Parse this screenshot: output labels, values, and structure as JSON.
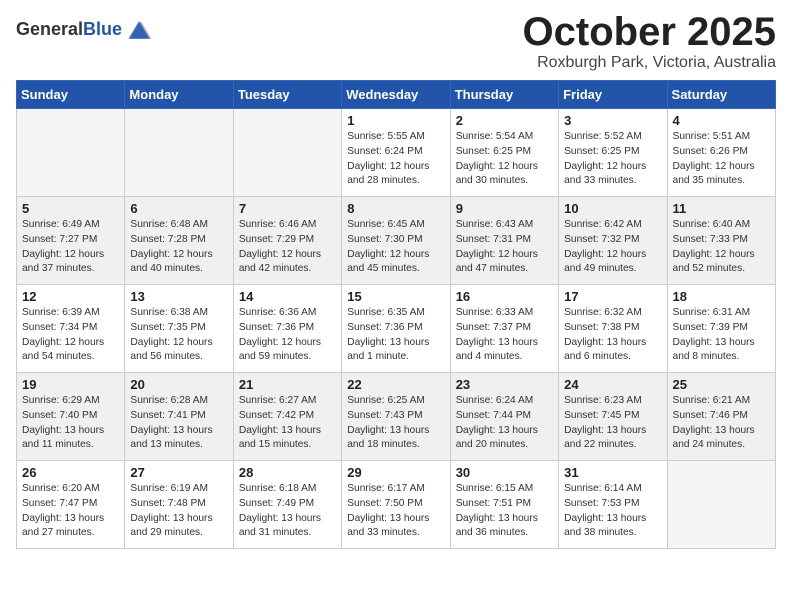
{
  "header": {
    "logo_line1": "General",
    "logo_line2": "Blue",
    "month": "October 2025",
    "location": "Roxburgh Park, Victoria, Australia"
  },
  "weekdays": [
    "Sunday",
    "Monday",
    "Tuesday",
    "Wednesday",
    "Thursday",
    "Friday",
    "Saturday"
  ],
  "weeks": [
    [
      {
        "day": "",
        "info": ""
      },
      {
        "day": "",
        "info": ""
      },
      {
        "day": "",
        "info": ""
      },
      {
        "day": "1",
        "info": "Sunrise: 5:55 AM\nSunset: 6:24 PM\nDaylight: 12 hours\nand 28 minutes."
      },
      {
        "day": "2",
        "info": "Sunrise: 5:54 AM\nSunset: 6:25 PM\nDaylight: 12 hours\nand 30 minutes."
      },
      {
        "day": "3",
        "info": "Sunrise: 5:52 AM\nSunset: 6:25 PM\nDaylight: 12 hours\nand 33 minutes."
      },
      {
        "day": "4",
        "info": "Sunrise: 5:51 AM\nSunset: 6:26 PM\nDaylight: 12 hours\nand 35 minutes."
      }
    ],
    [
      {
        "day": "5",
        "info": "Sunrise: 6:49 AM\nSunset: 7:27 PM\nDaylight: 12 hours\nand 37 minutes."
      },
      {
        "day": "6",
        "info": "Sunrise: 6:48 AM\nSunset: 7:28 PM\nDaylight: 12 hours\nand 40 minutes."
      },
      {
        "day": "7",
        "info": "Sunrise: 6:46 AM\nSunset: 7:29 PM\nDaylight: 12 hours\nand 42 minutes."
      },
      {
        "day": "8",
        "info": "Sunrise: 6:45 AM\nSunset: 7:30 PM\nDaylight: 12 hours\nand 45 minutes."
      },
      {
        "day": "9",
        "info": "Sunrise: 6:43 AM\nSunset: 7:31 PM\nDaylight: 12 hours\nand 47 minutes."
      },
      {
        "day": "10",
        "info": "Sunrise: 6:42 AM\nSunset: 7:32 PM\nDaylight: 12 hours\nand 49 minutes."
      },
      {
        "day": "11",
        "info": "Sunrise: 6:40 AM\nSunset: 7:33 PM\nDaylight: 12 hours\nand 52 minutes."
      }
    ],
    [
      {
        "day": "12",
        "info": "Sunrise: 6:39 AM\nSunset: 7:34 PM\nDaylight: 12 hours\nand 54 minutes."
      },
      {
        "day": "13",
        "info": "Sunrise: 6:38 AM\nSunset: 7:35 PM\nDaylight: 12 hours\nand 56 minutes."
      },
      {
        "day": "14",
        "info": "Sunrise: 6:36 AM\nSunset: 7:36 PM\nDaylight: 12 hours\nand 59 minutes."
      },
      {
        "day": "15",
        "info": "Sunrise: 6:35 AM\nSunset: 7:36 PM\nDaylight: 13 hours\nand 1 minute."
      },
      {
        "day": "16",
        "info": "Sunrise: 6:33 AM\nSunset: 7:37 PM\nDaylight: 13 hours\nand 4 minutes."
      },
      {
        "day": "17",
        "info": "Sunrise: 6:32 AM\nSunset: 7:38 PM\nDaylight: 13 hours\nand 6 minutes."
      },
      {
        "day": "18",
        "info": "Sunrise: 6:31 AM\nSunset: 7:39 PM\nDaylight: 13 hours\nand 8 minutes."
      }
    ],
    [
      {
        "day": "19",
        "info": "Sunrise: 6:29 AM\nSunset: 7:40 PM\nDaylight: 13 hours\nand 11 minutes."
      },
      {
        "day": "20",
        "info": "Sunrise: 6:28 AM\nSunset: 7:41 PM\nDaylight: 13 hours\nand 13 minutes."
      },
      {
        "day": "21",
        "info": "Sunrise: 6:27 AM\nSunset: 7:42 PM\nDaylight: 13 hours\nand 15 minutes."
      },
      {
        "day": "22",
        "info": "Sunrise: 6:25 AM\nSunset: 7:43 PM\nDaylight: 13 hours\nand 18 minutes."
      },
      {
        "day": "23",
        "info": "Sunrise: 6:24 AM\nSunset: 7:44 PM\nDaylight: 13 hours\nand 20 minutes."
      },
      {
        "day": "24",
        "info": "Sunrise: 6:23 AM\nSunset: 7:45 PM\nDaylight: 13 hours\nand 22 minutes."
      },
      {
        "day": "25",
        "info": "Sunrise: 6:21 AM\nSunset: 7:46 PM\nDaylight: 13 hours\nand 24 minutes."
      }
    ],
    [
      {
        "day": "26",
        "info": "Sunrise: 6:20 AM\nSunset: 7:47 PM\nDaylight: 13 hours\nand 27 minutes."
      },
      {
        "day": "27",
        "info": "Sunrise: 6:19 AM\nSunset: 7:48 PM\nDaylight: 13 hours\nand 29 minutes."
      },
      {
        "day": "28",
        "info": "Sunrise: 6:18 AM\nSunset: 7:49 PM\nDaylight: 13 hours\nand 31 minutes."
      },
      {
        "day": "29",
        "info": "Sunrise: 6:17 AM\nSunset: 7:50 PM\nDaylight: 13 hours\nand 33 minutes."
      },
      {
        "day": "30",
        "info": "Sunrise: 6:15 AM\nSunset: 7:51 PM\nDaylight: 13 hours\nand 36 minutes."
      },
      {
        "day": "31",
        "info": "Sunrise: 6:14 AM\nSunset: 7:53 PM\nDaylight: 13 hours\nand 38 minutes."
      },
      {
        "day": "",
        "info": ""
      }
    ]
  ],
  "shaded_rows": [
    1,
    3
  ]
}
